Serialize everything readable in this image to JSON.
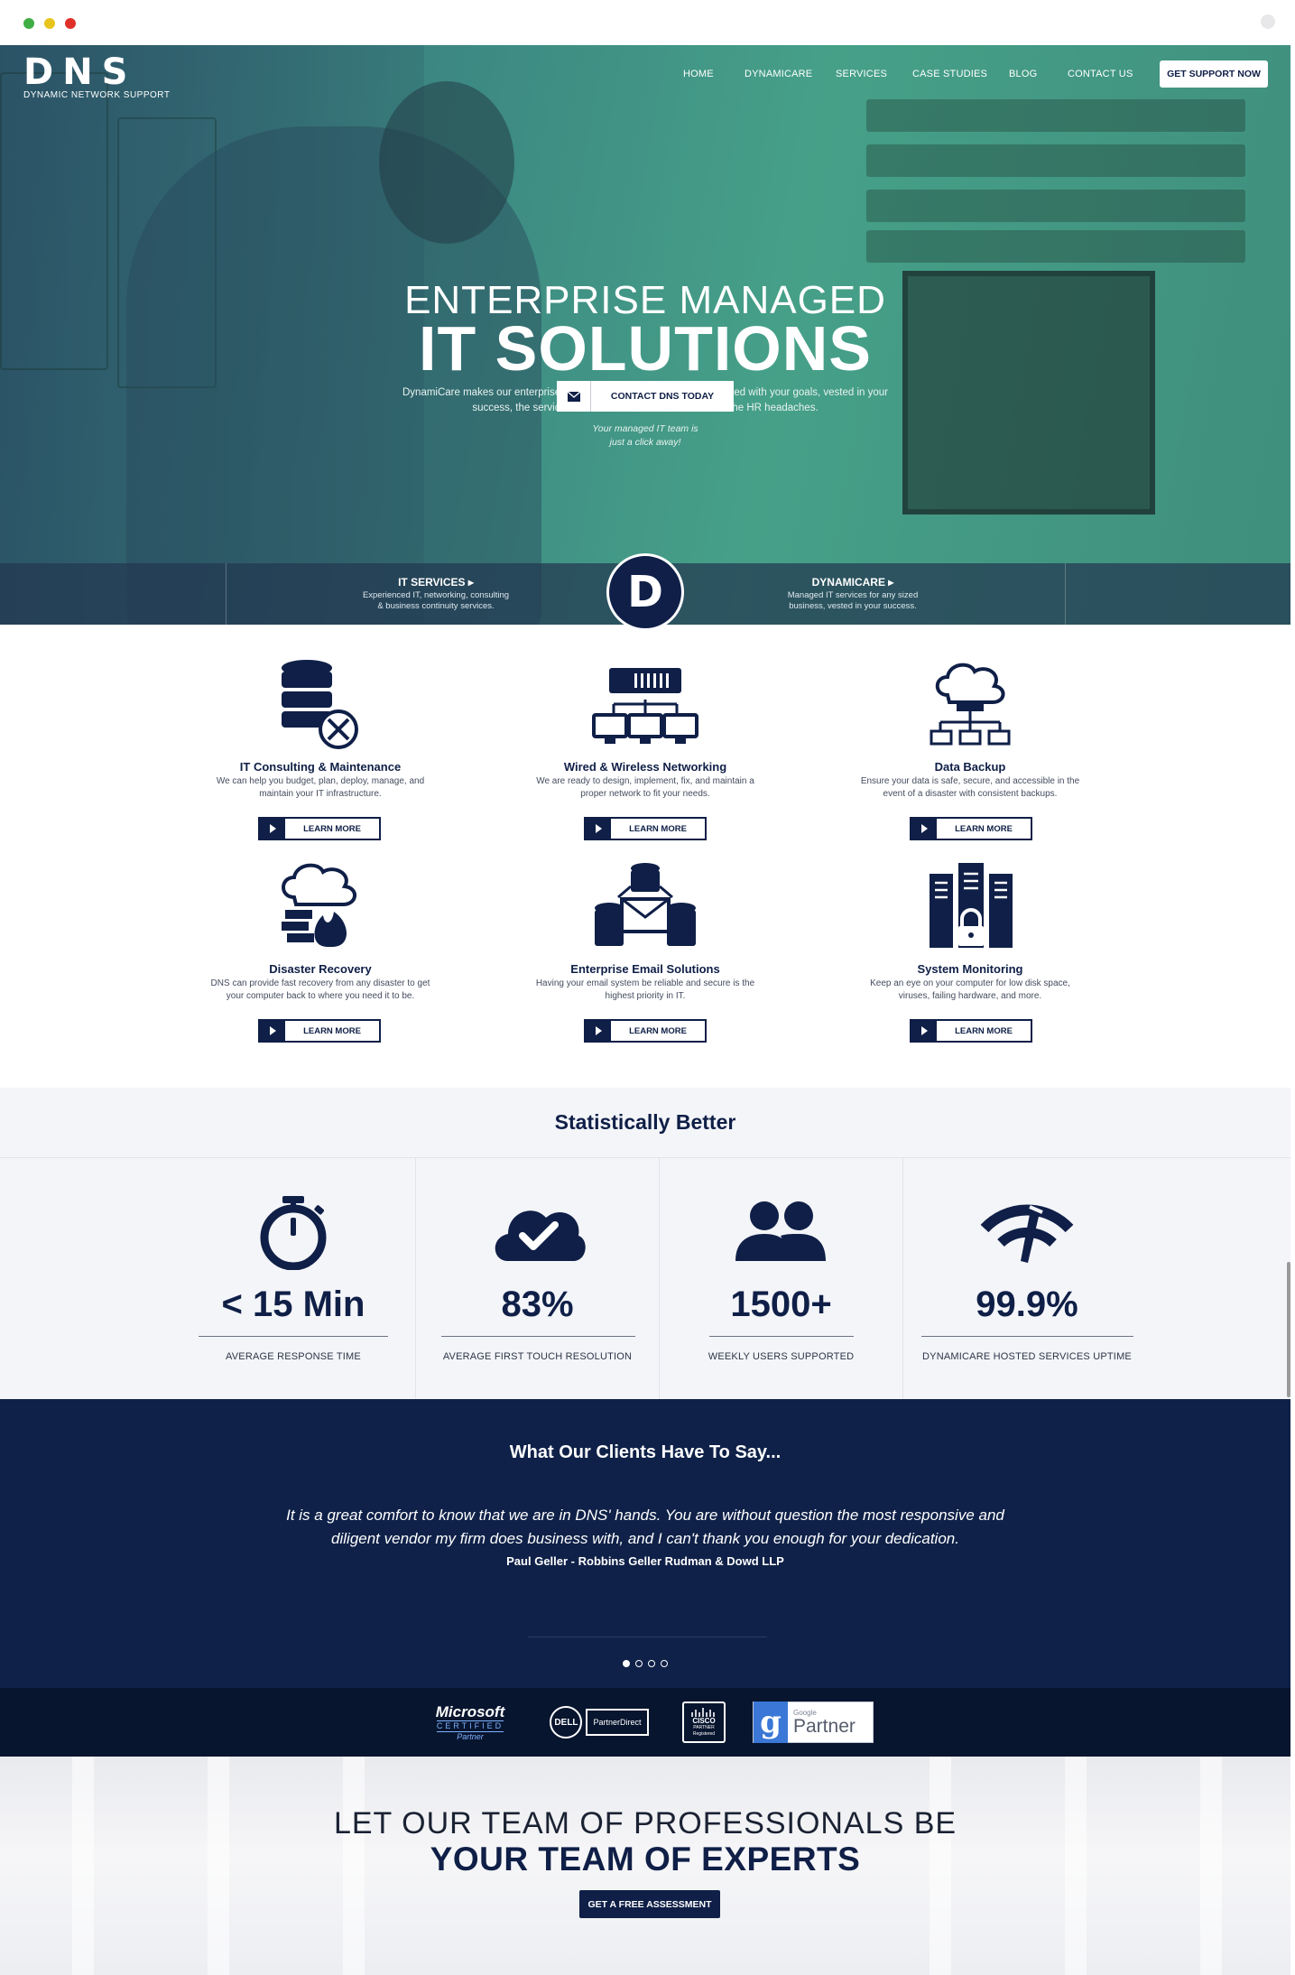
{
  "brand": {
    "logo_text": "DNS",
    "tagline": "DYNAMIC NETWORK SUPPORT"
  },
  "nav": {
    "items": [
      "HOME",
      "DYNAMICARE",
      "SERVICES",
      "CASE STUDIES",
      "BLOG",
      "CONTACT US"
    ],
    "cta": "GET SUPPORT NOW"
  },
  "hero": {
    "title_line1": "ENTERPRISE MANAGED",
    "title_line2": "IT SOLUTIONS",
    "description": "DynamiCare makes our enterprise IT team a part of your business, aligned with your goals, vested in your success, the service and care of a full-time staff without the HR headaches.",
    "button_label": "CONTACT DNS TODAY",
    "tagline_line1": "Your managed IT team is",
    "tagline_line2": "just a click away!",
    "bar_left": {
      "title": "IT SERVICES ▸",
      "line1": "Experienced IT, networking, consulting",
      "line2": "& business continuity services."
    },
    "badge": "D",
    "bar_right": {
      "title": "DYNAMICARE ▸",
      "line1": "Managed IT services for any sized",
      "line2": "business, vested in your success."
    }
  },
  "services": [
    {
      "icon": "database-tools-icon",
      "title": "IT Consulting & Maintenance",
      "line1": "We can help you budget, plan, deploy, manage, and",
      "line2": "maintain your IT infrastructure.",
      "button": "LEARN MORE"
    },
    {
      "icon": "network-switch-icon",
      "title": "Wired & Wireless Networking",
      "line1": "We are ready to design, implement, fix, and maintain a",
      "line2": "proper network to fit your needs.",
      "button": "LEARN MORE"
    },
    {
      "icon": "cloud-backup-icon",
      "title": "Data Backup",
      "line1": "Ensure your data is safe, secure, and accessible in the",
      "line2": "event of a disaster with consistent backups.",
      "button": "LEARN MORE"
    },
    {
      "icon": "fire-cloud-icon",
      "title": "Disaster Recovery",
      "line1": "DNS can provide fast recovery from any disaster to get",
      "line2": "your computer back to where you need it to be.",
      "button": "LEARN MORE"
    },
    {
      "icon": "email-servers-icon",
      "title": "Enterprise Email Solutions",
      "line1": "Having your email system be reliable and secure is the",
      "line2": "highest priority in IT.",
      "button": "LEARN MORE"
    },
    {
      "icon": "server-lock-icon",
      "title": "System Monitoring",
      "line1": "Keep an eye on your computer for low disk space,",
      "line2": "viruses, failing hardware, and more.",
      "button": "LEARN MORE"
    }
  ],
  "stats": {
    "title": "Statistically Better",
    "items": [
      {
        "icon": "stopwatch-icon",
        "value": "< 15 Min",
        "label": "AVERAGE RESPONSE TIME"
      },
      {
        "icon": "cloud-check-icon",
        "value": "83%",
        "label": "AVERAGE FIRST TOUCH RESOLUTION"
      },
      {
        "icon": "users-icon",
        "value": "1500+",
        "label": "WEEKLY USERS SUPPORTED"
      },
      {
        "icon": "gauge-icon",
        "value": "99.9%",
        "label": "DYNAMICARE HOSTED SERVICES UPTIME"
      }
    ]
  },
  "testimonials": {
    "title": "What Our Clients Have To Say...",
    "quote_line1": "It is a great comfort to know that we are in DNS' hands. You are without question the most responsive and",
    "quote_line2": "diligent vendor my firm does business with, and I can't thank you enough for your dedication.",
    "author": "Paul Geller - Robbins Geller Rudman & Dowd LLP",
    "slides": 4,
    "active_slide": 1
  },
  "partners": [
    {
      "name": "Microsoft",
      "line2": "CERTIFIED",
      "line3": "Partner"
    },
    {
      "name": "DELL",
      "line2": "PartnerDirect"
    },
    {
      "name": "CISCO",
      "line2": "PARTNER",
      "line3": "Registered"
    },
    {
      "name": "Google",
      "line2": "Partner",
      "glyph": "g"
    }
  ],
  "cta": {
    "line1": "LET OUR TEAM OF PROFESSIONALS BE",
    "line2": "YOUR TEAM OF EXPERTS",
    "button": "GET A FREE ASSESSMENT"
  },
  "colors": {
    "navy": "#0f1f47",
    "hero_green": "#46a088",
    "stats_bg": "#f4f5f9",
    "testimonial_bg": "#0f2148"
  }
}
